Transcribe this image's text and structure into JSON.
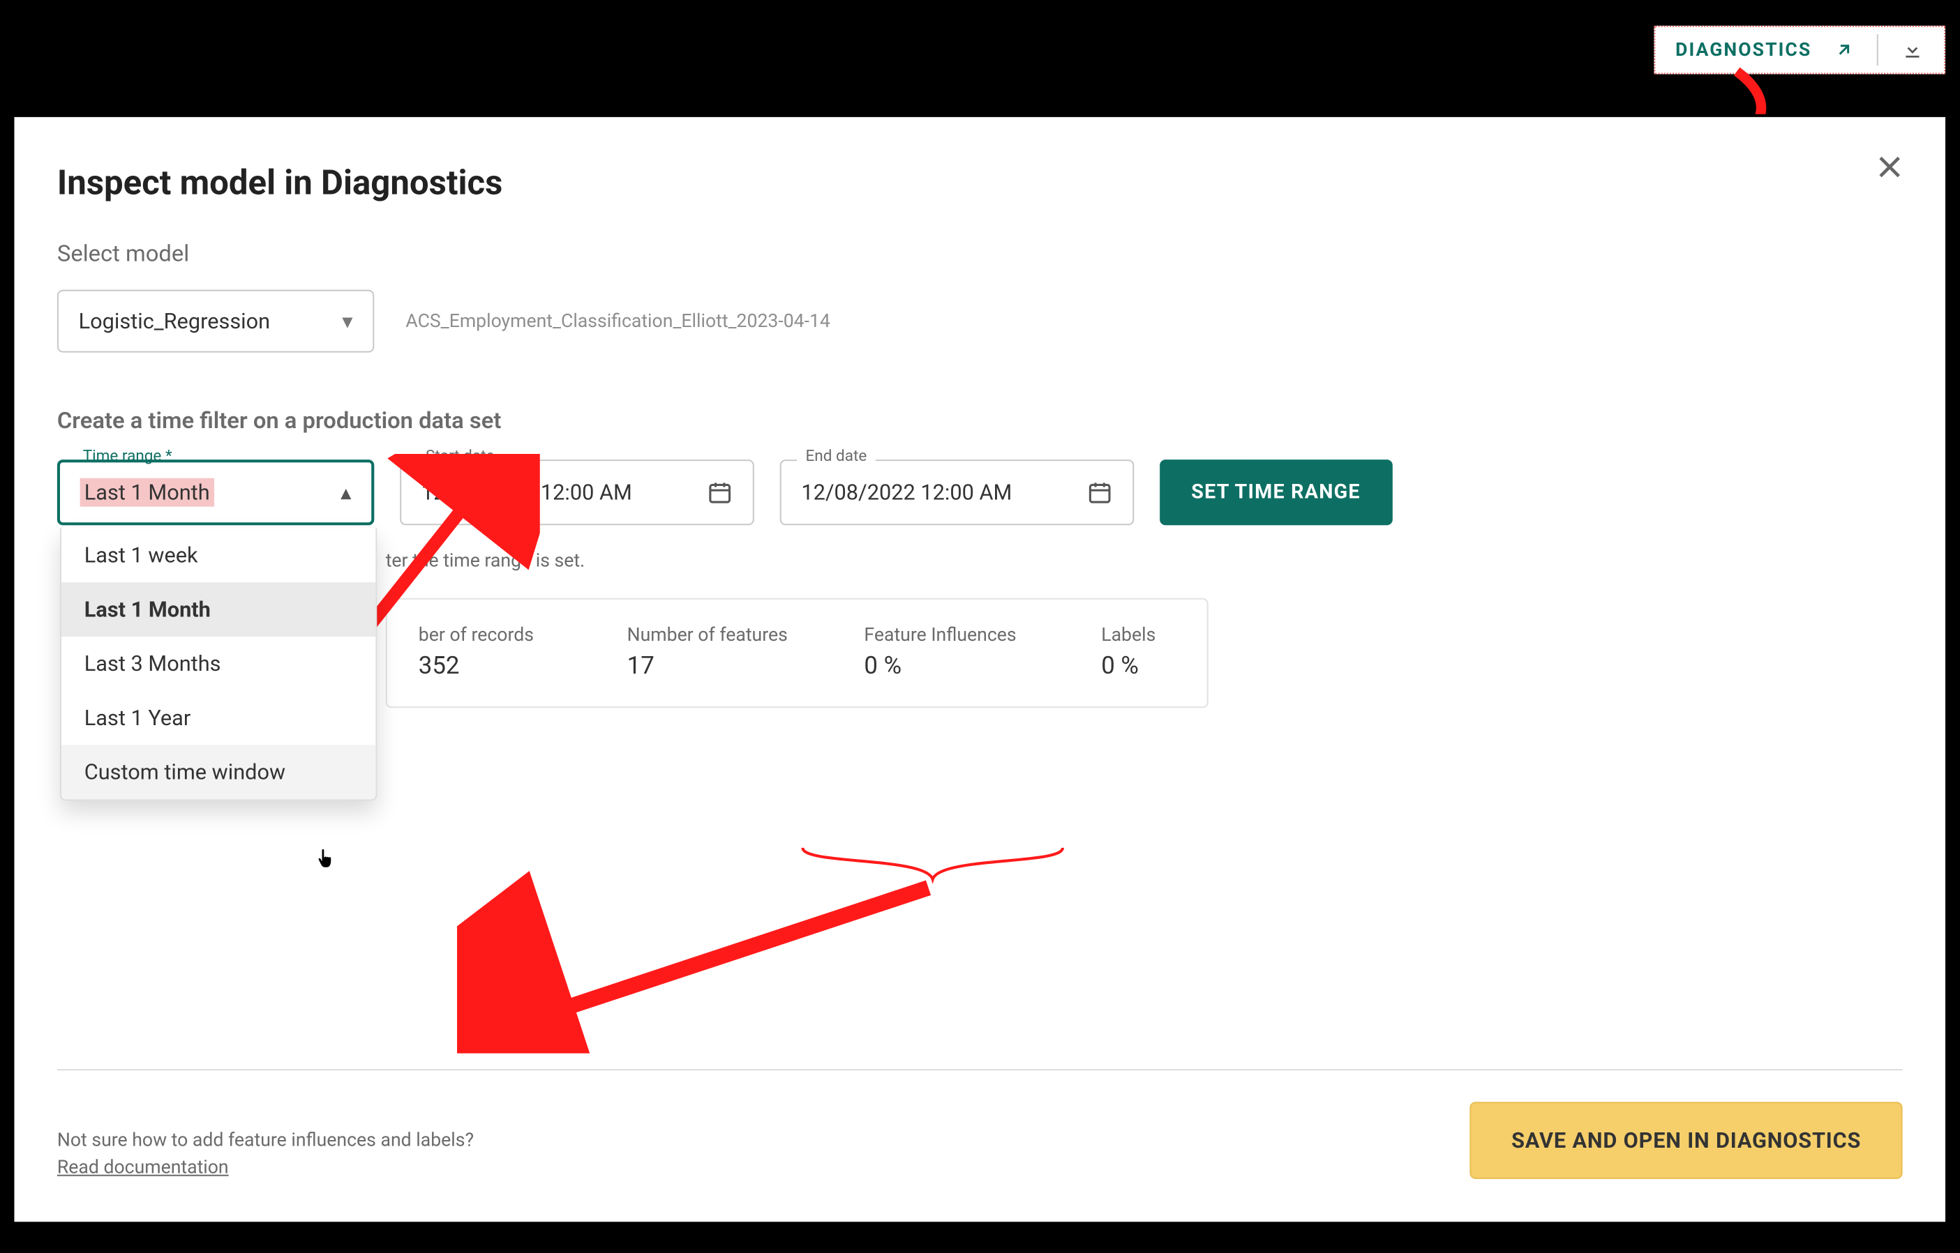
{
  "diagnostics_chip": {
    "label": "DIAGNOSTICS"
  },
  "modal": {
    "title": "Inspect model in Diagnostics",
    "select_model_label": "Select model",
    "model_selected": "Logistic_Regression",
    "model_context": "ACS_Employment_Classification_Elliott_2023-04-14",
    "time_filter_label": "Create a time filter on a production data set",
    "time_range": {
      "float_label": "Time range *",
      "selected": "Last 1 Month",
      "options": [
        "Last 1 week",
        "Last 1 Month",
        "Last 3 Months",
        "Last 1 Year",
        "Custom time window"
      ]
    },
    "start_date": {
      "label": "Start date",
      "value": "12/02/2022 12:00 AM"
    },
    "end_date": {
      "label": "End date",
      "value": "12/08/2022 12:00 AM"
    },
    "set_time_range_btn": "SET TIME RANGE",
    "after_set_hint": "ter the time range is set.",
    "stats": {
      "num_records_label": "ber of records",
      "num_records_value": "352",
      "num_features_label": "Number of features",
      "num_features_value": "17",
      "feat_infl_label": "Feature Influences",
      "feat_infl_value": "0 %",
      "labels_label": "Labels",
      "labels_value": "0 %"
    },
    "footer": {
      "help_q": "Not sure how to add feature influences and labels?",
      "help_link": "Read documentation",
      "save_btn": "SAVE AND OPEN IN DIAGNOSTICS"
    }
  }
}
